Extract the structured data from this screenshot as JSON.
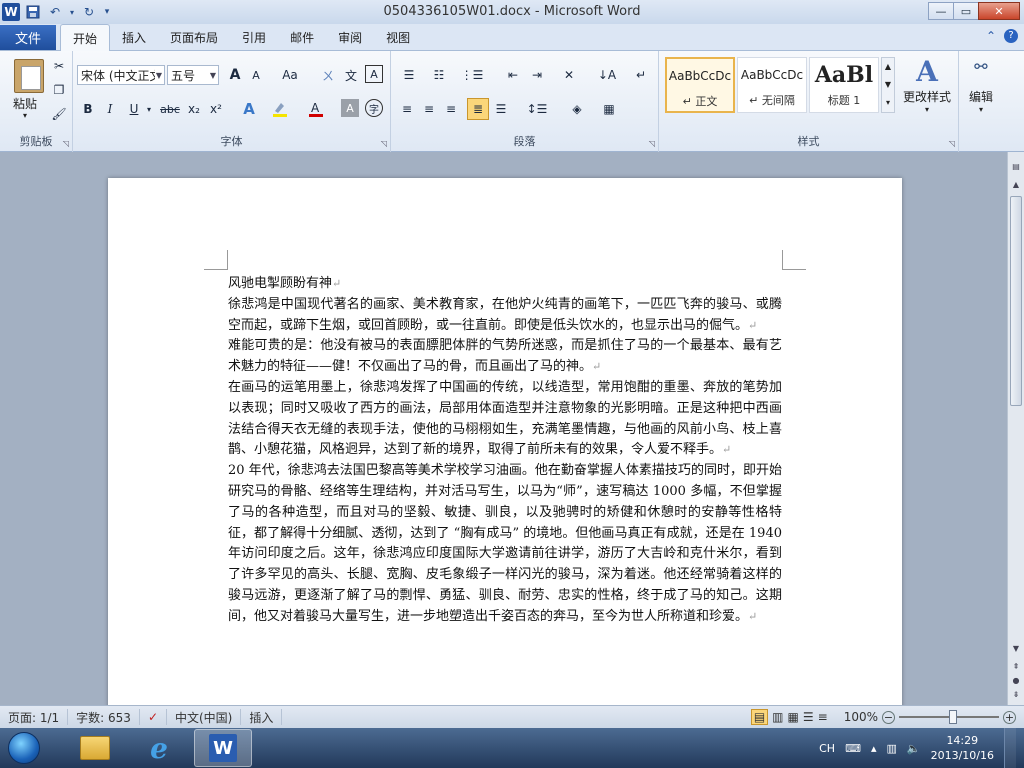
{
  "window": {
    "title": "0504336105W01.docx - Microsoft Word",
    "app_icon_letter": "W",
    "controls": {
      "minimize": "—",
      "maximize": "▭",
      "close": "✕"
    }
  },
  "ribbon": {
    "file_tab": "文件",
    "tabs": [
      "开始",
      "插入",
      "页面布局",
      "引用",
      "邮件",
      "审阅",
      "视图"
    ],
    "clipboard": {
      "paste": "粘贴",
      "group": "剪贴板"
    },
    "font": {
      "name": "宋体 (中文正文",
      "size": "五号",
      "group": "字体",
      "buttons": {
        "bold": "B",
        "italic": "I",
        "underline": "U",
        "strike": "abc",
        "sub": "x₂",
        "sup": "x²",
        "grow": "A",
        "shrink": "A",
        "case": "Aa",
        "clear": "A"
      }
    },
    "paragraph": {
      "group": "段落"
    },
    "styles": {
      "group": "样式",
      "items": [
        {
          "preview": "AaBbCcDc",
          "name": "↵ 正文"
        },
        {
          "preview": "AaBbCcDc",
          "name": "↵ 无间隔"
        },
        {
          "preview": "AaBl",
          "name": "标题 1"
        }
      ],
      "change": "更改样式"
    },
    "edit": {
      "label": "编辑"
    }
  },
  "document": {
    "paragraphs": [
      "风驰电掣顾盼有神",
      "徐悲鸿是中国现代著名的画家、美术教育家，在他炉火纯青的画笔下，一匹匹飞奔的骏马、或腾空而起，或蹄下生烟，或回首顾盼，或一往直前。即使是低头饮水的，也显示出马的倔气。",
      "难能可贵的是：他没有被马的表面膘肥体胖的气势所迷惑，而是抓住了马的一个最基本、最有艺术魅力的特征——健！不仅画出了马的骨，而且画出了马的神。",
      "在画马的运笔用墨上，徐悲鸿发挥了中国画的传统，以线造型，常用饱酣的重墨、奔放的笔势加以表现；同时又吸收了西方的画法，局部用体面造型并注意物象的光影明暗。正是这种把中西画法结合得天衣无缝的表现手法，使他的马栩栩如生，充满笔墨情趣，与他画的风前小鸟、枝上喜鹊、小憩花猫，风格迥异，达到了新的境界，取得了前所未有的效果，令人爱不释手。",
      "20 年代，徐悲鸿去法国巴黎高等美术学校学习油画。他在勤奋掌握人体素描技巧的同时，即开始研究马的骨骼、经络等生理结构，并对活马写生，以马为“师”，速写稿达 1000 多幅，不但掌握了马的各种造型，而且对马的坚毅、敏捷、驯良，以及驰骋时的矫健和休憩时的安静等性格特征，都了解得十分细腻、透彻，达到了 “胸有成马” 的境地。但他画马真正有成就，还是在 1940 年访问印度之后。这年，徐悲鸿应印度国际大学邀请前往讲学，游历了大吉岭和克什米尔，看到了许多罕见的高头、长腿、宽胸、皮毛象缎子一样闪光的骏马，深为着迷。他还经常骑着这样的骏马远游，更逐渐了解了马的剽悍、勇猛、驯良、耐劳、忠实的性格，终于成了马的知己。这期间，他又对着骏马大量写生，进一步地塑造出千姿百态的奔马，至今为世人所称道和珍爱。"
    ],
    "para_mark": "↵"
  },
  "status": {
    "page": "页面: 1/1",
    "words": "字数: 653",
    "language": "中文(中国)",
    "mode": "插入",
    "zoom": "100%"
  },
  "taskbar": {
    "ime": "CH",
    "time": "14:29",
    "date": "2013/10/16"
  },
  "colors": {
    "file_tab": "#1f4e9c",
    "accent": "#2a5db0"
  }
}
